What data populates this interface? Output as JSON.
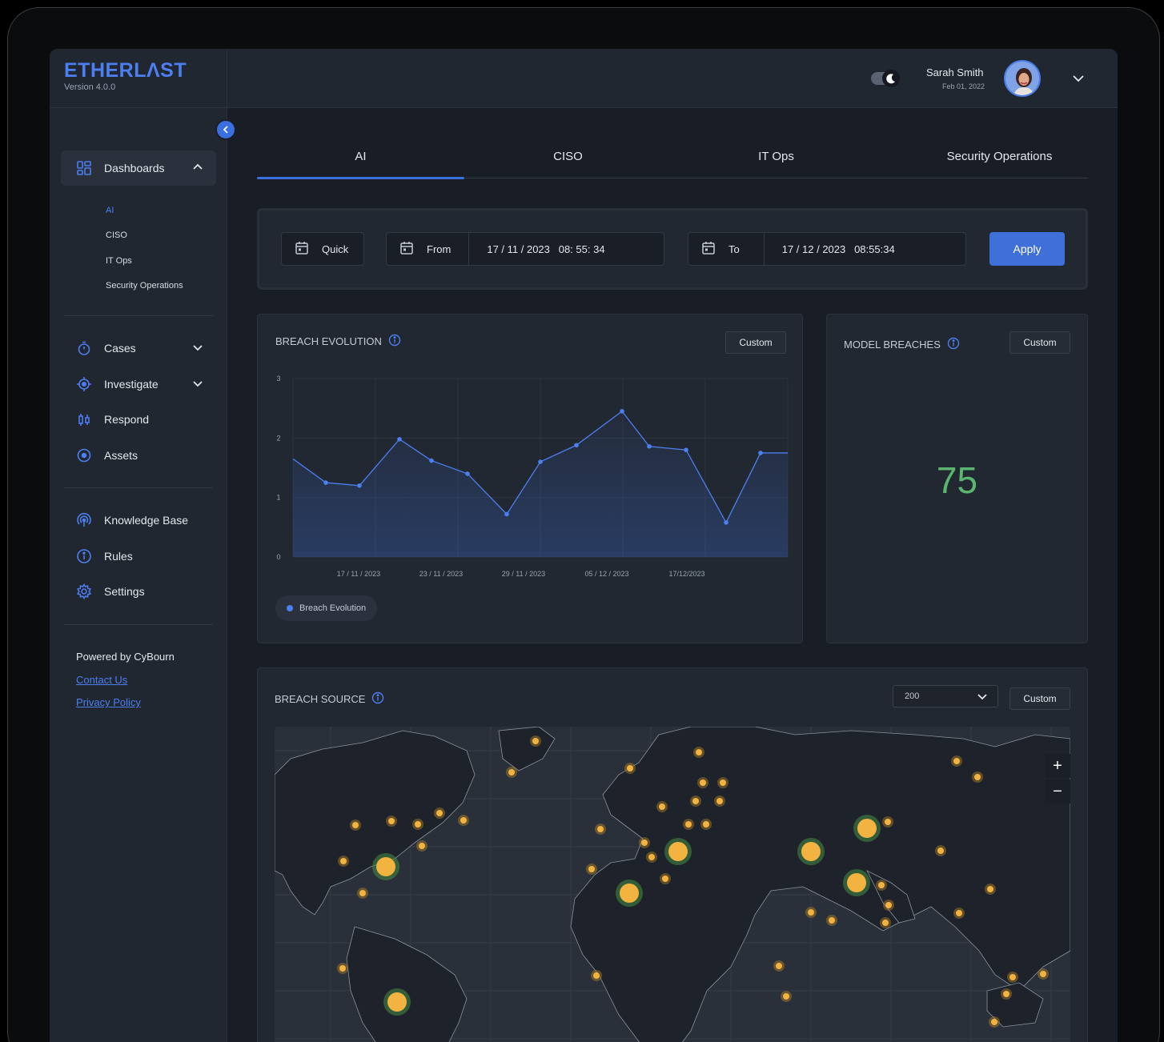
{
  "brand": {
    "logo": "ETHERLΛST",
    "version": "Version 4.0.0"
  },
  "user": {
    "name": "Sarah Smith",
    "date": "Feb 01, 2022"
  },
  "sidebar": {
    "dashboards_label": "Dashboards",
    "sub_items": [
      "AI",
      "CISO",
      "IT Ops",
      "Security Operations"
    ],
    "items": [
      "Cases",
      "Investigate",
      "Respond",
      "Assets",
      "Knowledge Base",
      "Rules",
      "Settings"
    ],
    "powered_by": "Powered by CyBourn",
    "contact": "Contact Us",
    "privacy": "Privacy Policy"
  },
  "tabs": [
    "AI",
    "CISO",
    "IT Ops",
    "Security Operations"
  ],
  "filters": {
    "quick": "Quick",
    "from_label": "From",
    "from_value": "17 / 11 / 2023   08: 55: 34",
    "to_label": "To",
    "to_value": "17 / 12 / 2023   08:55:34",
    "apply": "Apply"
  },
  "breach_evolution": {
    "title": "BREACH EVOLUTION",
    "custom": "Custom",
    "legend": "Breach Evolution"
  },
  "model_breaches": {
    "title": "MODEL BREACHES",
    "custom": "Custom",
    "value": "75"
  },
  "breach_source": {
    "title": "BREACH SOURCE",
    "select_value": "200",
    "custom": "Custom",
    "zoom_in": "+",
    "zoom_out": "−"
  },
  "chart_data": {
    "type": "line",
    "title": "BREACH EVOLUTION",
    "x_ticks": [
      "17 / 11 / 2023",
      "23 / 11 / 2023",
      "29 / 11 / 2023",
      "05 / 12 / 2023",
      "17/12/2023"
    ],
    "y_ticks": [
      "0",
      "1",
      "2",
      "3"
    ],
    "ylim": [
      0,
      3
    ],
    "series": [
      {
        "name": "Breach Evolution",
        "values": [
          1.65,
          1.25,
          1.2,
          1.98,
          1.62,
          1.4,
          0.72,
          1.6,
          1.88,
          2.45,
          1.86,
          1.8,
          0.58,
          1.75,
          1.75
        ]
      }
    ],
    "grid": true,
    "legend": "bottom-left"
  },
  "colors": {
    "accent": "#3b6fe0",
    "value_green": "#5ab56e",
    "marker": "#f2b340"
  }
}
